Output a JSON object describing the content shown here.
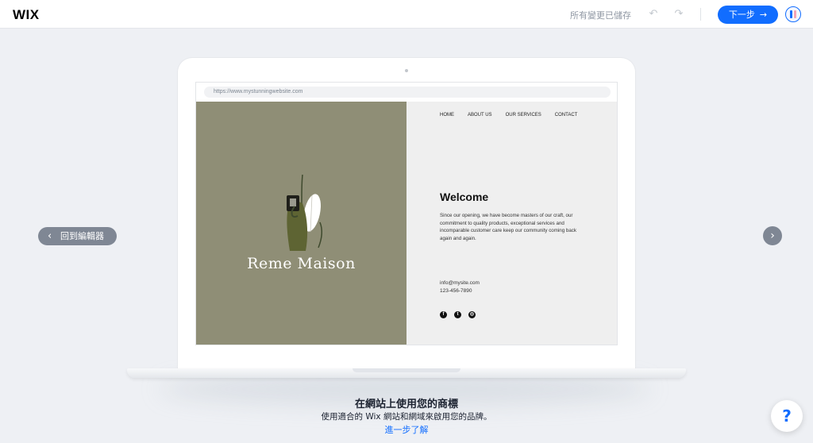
{
  "header": {
    "logo": "WIX",
    "status": "所有變更已儲存",
    "undo_icon": "↶",
    "redo_icon": "↷",
    "next_label": "下一步",
    "next_arrow": "→"
  },
  "nav": {
    "back_chevron": "‹",
    "back_label": "回到編輯器",
    "next_chevron": "›"
  },
  "preview": {
    "url": "https://www.mystunningwebsite.com",
    "brand_name": "Reme Maison",
    "site_nav": [
      "HOME",
      "ABOUT US",
      "OUR SERVICES",
      "CONTACT"
    ],
    "welcome": "Welcome",
    "intro": "Since our opening, we have become masters of our craft, our commitment to quality products, exceptional services and incomparable customer care keep our community coming back again and again.",
    "email": "info@mysite.com",
    "phone": "123-456-7890",
    "socials": [
      {
        "icon": "facebook-icon",
        "glyph": "f"
      },
      {
        "icon": "twitter-icon",
        "glyph": "t"
      },
      {
        "icon": "instagram-icon",
        "glyph": "◎"
      }
    ]
  },
  "caption": {
    "title": "在網站上使用您的商標",
    "subtitle": "使用適合的 Wix 網站和網域來啟用您的品牌。",
    "learn_more": "進一步了解"
  },
  "help": {
    "label": "?"
  },
  "colors": {
    "accent": "#116dff",
    "brand_panel": "#8f8e76",
    "background": "#eef0f4"
  }
}
